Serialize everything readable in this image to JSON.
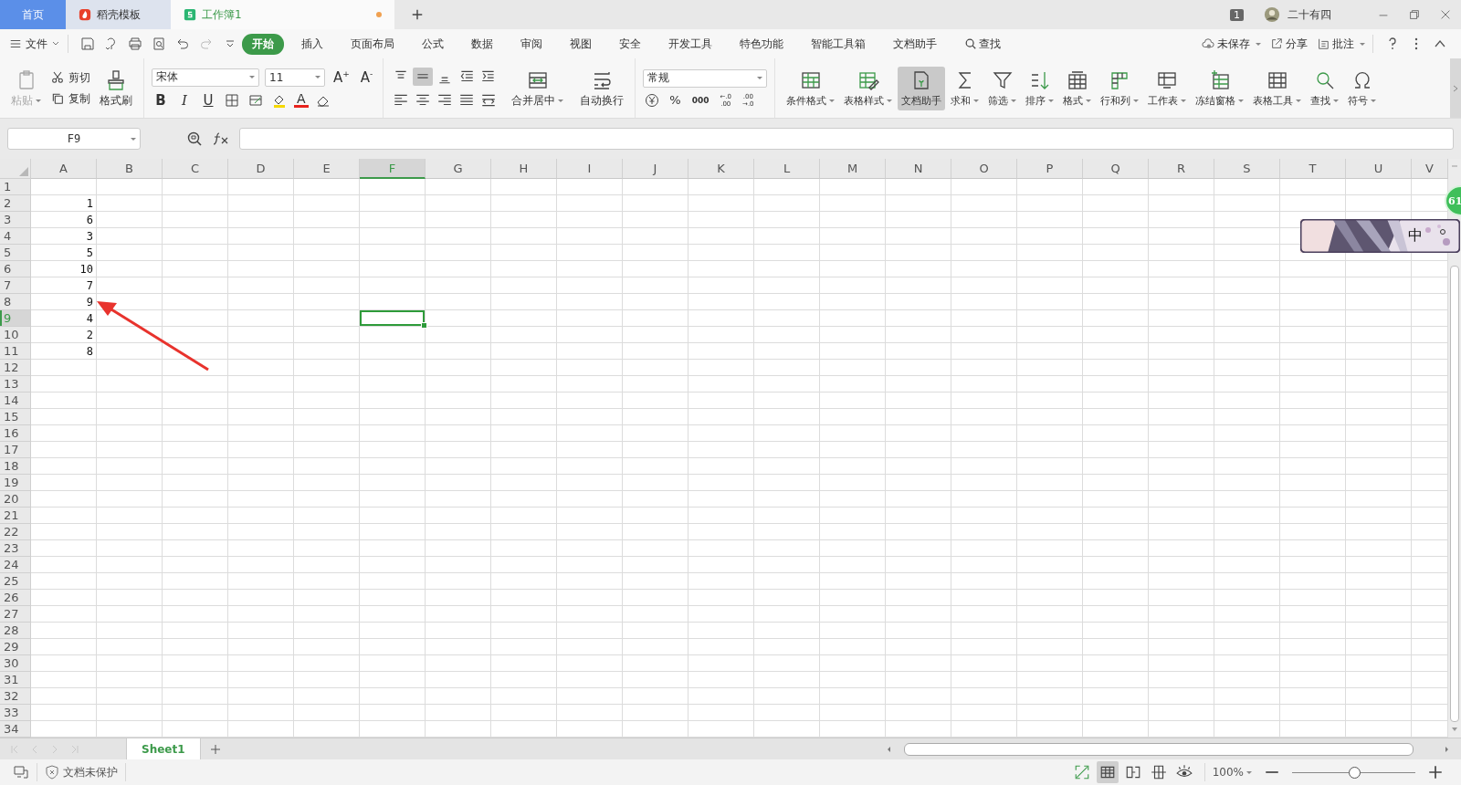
{
  "tabs": [
    {
      "label": "首页",
      "selected": false,
      "kind": "home"
    },
    {
      "label": "稻壳模板",
      "selected": false,
      "kind": "docer"
    },
    {
      "label": "工作簿1",
      "selected": true,
      "kind": "sheet",
      "unsaved": true
    }
  ],
  "title_bar": {
    "badge": "1",
    "user": "二十有四"
  },
  "menu": {
    "file": "文件",
    "items": [
      {
        "label": "开始",
        "selected": true
      },
      {
        "label": "插入",
        "selected": false
      },
      {
        "label": "页面布局",
        "selected": false
      },
      {
        "label": "公式",
        "selected": false
      },
      {
        "label": "数据",
        "selected": false
      },
      {
        "label": "审阅",
        "selected": false
      },
      {
        "label": "视图",
        "selected": false
      },
      {
        "label": "安全",
        "selected": false
      },
      {
        "label": "开发工具",
        "selected": false
      },
      {
        "label": "特色功能",
        "selected": false
      },
      {
        "label": "智能工具箱",
        "selected": false
      },
      {
        "label": "文档助手",
        "selected": false
      }
    ],
    "search": "查找",
    "unsaved": "未保存",
    "share": "分享",
    "comment": "批注"
  },
  "clipboard": [
    {
      "label": "粘贴",
      "kind": "paste",
      "disabled": true,
      "dropdown": true
    },
    {
      "label": "剪切",
      "kind": "cut",
      "disabled": false,
      "dropdown": false
    },
    {
      "label": "复制",
      "kind": "copy",
      "disabled": false,
      "dropdown": false
    },
    {
      "label": "格式刷",
      "kind": "brush",
      "disabled": false,
      "dropdown": false
    }
  ],
  "font": {
    "name": "宋体",
    "size": "11",
    "grow": "A$^{+}$",
    "shrink": "A$^{-}$",
    "styles": [
      "B",
      "I",
      "U"
    ],
    "color_letter": "A"
  },
  "alignment": [
    {
      "selected": false
    },
    {
      "selected": true
    },
    {
      "selected": false
    }
  ],
  "align_buttons": [
    {
      "label": "合并居中",
      "kind": "merge",
      "dropdown": true
    },
    {
      "label": "自动换行",
      "kind": "wrap",
      "dropdown": false
    }
  ],
  "number": {
    "format": "常规",
    "percent": "%",
    "thousands": "000",
    "inc_top": "←.0",
    "inc_bottom": ".00",
    "dec_top": ".00",
    "dec_bottom": "→.0"
  },
  "tools": [
    {
      "label": "条件格式",
      "kind": "table",
      "dropdown": true,
      "selected": false
    },
    {
      "label": "表格样式",
      "kind": "tablepen",
      "dropdown": true,
      "selected": false
    },
    {
      "label": "文档助手",
      "kind": "doc",
      "dropdown": false,
      "selected": true
    },
    {
      "label": "求和",
      "kind": "sigma",
      "dropdown": true,
      "selected": false
    },
    {
      "label": "筛选",
      "kind": "filter",
      "dropdown": true,
      "selected": false
    },
    {
      "label": "排序",
      "kind": "sort",
      "dropdown": true,
      "selected": false
    },
    {
      "label": "格式",
      "kind": "format",
      "dropdown": true,
      "selected": false
    },
    {
      "label": "行和列",
      "kind": "rowcol",
      "dropdown": true,
      "selected": false
    },
    {
      "label": "工作表",
      "kind": "sheet",
      "dropdown": true,
      "selected": false
    },
    {
      "label": "冻结窗格",
      "kind": "freeze",
      "dropdown": true,
      "selected": false
    },
    {
      "label": "表格工具",
      "kind": "tabletool",
      "dropdown": true,
      "selected": false
    },
    {
      "label": "查找",
      "kind": "search",
      "dropdown": true,
      "selected": false
    },
    {
      "label": "符号",
      "kind": "omega",
      "dropdown": true,
      "selected": false
    }
  ],
  "name_box": "F9",
  "columns": [
    {
      "label": "A",
      "selected": false
    },
    {
      "label": "B",
      "selected": false
    },
    {
      "label": "C",
      "selected": false
    },
    {
      "label": "D",
      "selected": false
    },
    {
      "label": "E",
      "selected": false
    },
    {
      "label": "F",
      "selected": true
    },
    {
      "label": "G",
      "selected": false
    },
    {
      "label": "H",
      "selected": false
    },
    {
      "label": "I",
      "selected": false
    },
    {
      "label": "J",
      "selected": false
    },
    {
      "label": "K",
      "selected": false
    },
    {
      "label": "L",
      "selected": false
    },
    {
      "label": "M",
      "selected": false
    },
    {
      "label": "N",
      "selected": false
    },
    {
      "label": "O",
      "selected": false
    },
    {
      "label": "P",
      "selected": false
    },
    {
      "label": "Q",
      "selected": false
    },
    {
      "label": "R",
      "selected": false
    },
    {
      "label": "S",
      "selected": false
    },
    {
      "label": "T",
      "selected": false
    },
    {
      "label": "U",
      "selected": false
    },
    {
      "label": "V",
      "selected": false
    }
  ],
  "rows": [
    {
      "label": "1",
      "selected": false
    },
    {
      "label": "2",
      "selected": false,
      "value": "1"
    },
    {
      "label": "3",
      "selected": false,
      "value": "6"
    },
    {
      "label": "4",
      "selected": false,
      "value": "3"
    },
    {
      "label": "5",
      "selected": false,
      "value": "5"
    },
    {
      "label": "6",
      "selected": false,
      "value": "10"
    },
    {
      "label": "7",
      "selected": false,
      "value": "7"
    },
    {
      "label": "8",
      "selected": false,
      "value": "9"
    },
    {
      "label": "9",
      "selected": true,
      "value": "4"
    },
    {
      "label": "10",
      "selected": false,
      "value": "2"
    },
    {
      "label": "11",
      "selected": false,
      "value": "8"
    },
    {
      "label": "12",
      "selected": false
    },
    {
      "label": "13",
      "selected": false
    },
    {
      "label": "14",
      "selected": false
    },
    {
      "label": "15",
      "selected": false
    },
    {
      "label": "16",
      "selected": false
    },
    {
      "label": "17",
      "selected": false
    },
    {
      "label": "18",
      "selected": false
    },
    {
      "label": "19",
      "selected": false
    },
    {
      "label": "20",
      "selected": false
    },
    {
      "label": "21",
      "selected": false
    },
    {
      "label": "22",
      "selected": false
    },
    {
      "label": "23",
      "selected": false
    },
    {
      "label": "24",
      "selected": false
    },
    {
      "label": "25",
      "selected": false
    },
    {
      "label": "26",
      "selected": false
    },
    {
      "label": "27",
      "selected": false
    },
    {
      "label": "28",
      "selected": false
    },
    {
      "label": "29",
      "selected": false
    },
    {
      "label": "30",
      "selected": false
    },
    {
      "label": "31",
      "selected": false
    },
    {
      "label": "32",
      "selected": false
    },
    {
      "label": "33",
      "selected": false
    },
    {
      "label": "34",
      "selected": false
    }
  ],
  "sheets": [
    {
      "label": "Sheet1",
      "selected": true
    }
  ],
  "status": {
    "protection": "文档未保护",
    "zoom": "100%",
    "level": 0.5
  },
  "overlay": {
    "score": "61",
    "ime": "中"
  }
}
